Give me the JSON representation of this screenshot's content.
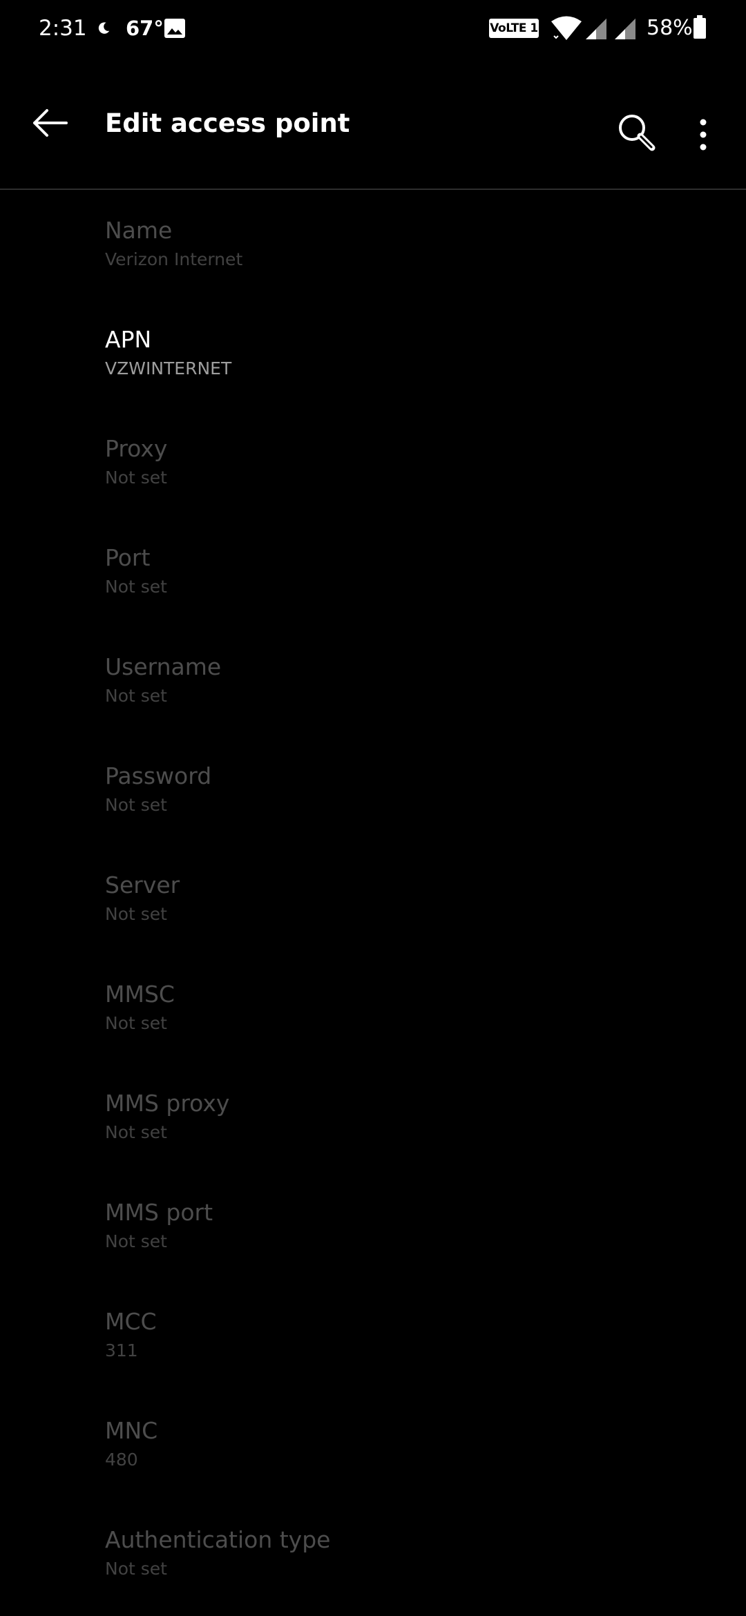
{
  "status_bar": {
    "time": "2:31",
    "temperature": "67°",
    "network_badge": "VoLTE 1",
    "battery": "58%",
    "icons": [
      "moon-icon",
      "image-icon",
      "wifi-icon",
      "signal-icon",
      "signal-icon",
      "battery-icon"
    ]
  },
  "app_bar": {
    "title": "Edit access point",
    "back_icon": "arrow-left-icon",
    "search_icon": "search-icon",
    "menu_icon": "more-vert-icon"
  },
  "settings": {
    "items": [
      {
        "title": "Name",
        "value": "Verizon Internet",
        "enabled": false
      },
      {
        "title": "APN",
        "value": "VZWINTERNET",
        "enabled": true
      },
      {
        "title": "Proxy",
        "value": "Not set",
        "enabled": false
      },
      {
        "title": "Port",
        "value": "Not set",
        "enabled": false
      },
      {
        "title": "Username",
        "value": "Not set",
        "enabled": false
      },
      {
        "title": "Password",
        "value": "Not set",
        "enabled": false
      },
      {
        "title": "Server",
        "value": "Not set",
        "enabled": false
      },
      {
        "title": "MMSC",
        "value": "Not set",
        "enabled": false
      },
      {
        "title": "MMS proxy",
        "value": "Not set",
        "enabled": false
      },
      {
        "title": "MMS port",
        "value": "Not set",
        "enabled": false
      },
      {
        "title": "MCC",
        "value": "311",
        "enabled": false
      },
      {
        "title": "MNC",
        "value": "480",
        "enabled": false
      },
      {
        "title": "Authentication type",
        "value": "Not set",
        "enabled": false
      }
    ]
  },
  "colors": {
    "background": "#000000",
    "text_primary": "#ffffff",
    "text_disabled": "#4d4d4d",
    "text_secondary": "#9e9e9e",
    "divider": "#2e2e2e"
  }
}
